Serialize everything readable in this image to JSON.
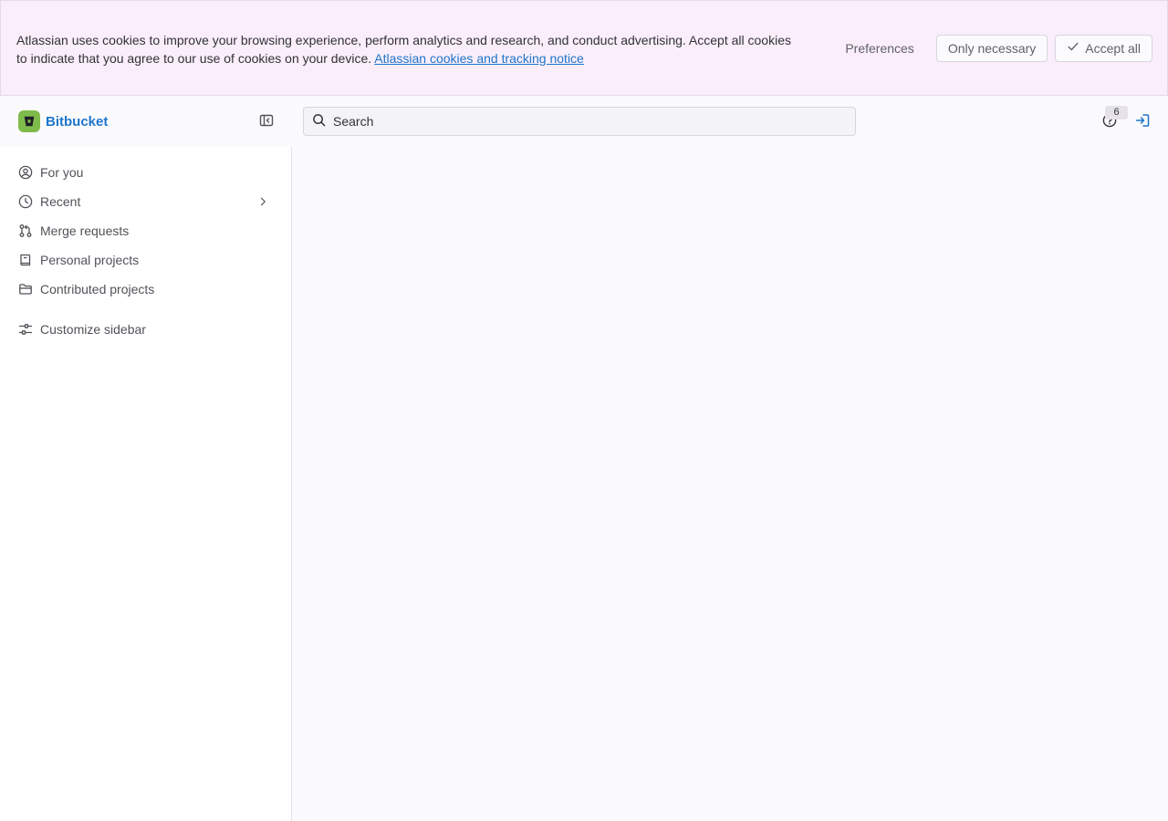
{
  "cookie_banner": {
    "message": "Atlassian uses cookies to improve your browsing experience, perform analytics and research, and conduct advertising. Accept all cookies to indicate that you agree to our use of cookies on your device.",
    "link_text": "Atlassian cookies and tracking notice",
    "preferences_label": "Preferences",
    "only_necessary_label": "Only necessary",
    "accept_all_label": "Accept all"
  },
  "header": {
    "brand_name": "Bitbucket",
    "search_placeholder": "Search",
    "help_badge_count": "6"
  },
  "sidebar": {
    "items": [
      {
        "label": "For you",
        "icon": "user-circle-icon"
      },
      {
        "label": "Recent",
        "icon": "clock-icon",
        "has_chevron": true
      },
      {
        "label": "Merge requests",
        "icon": "merge-request-icon"
      },
      {
        "label": "Personal projects",
        "icon": "book-icon"
      },
      {
        "label": "Contributed projects",
        "icon": "folder-icon"
      }
    ],
    "customize_label": "Customize sidebar"
  },
  "colors": {
    "banner_bg": "#f9eefa",
    "brand_logo": "#7fbb4a",
    "link": "#1f75cb"
  }
}
